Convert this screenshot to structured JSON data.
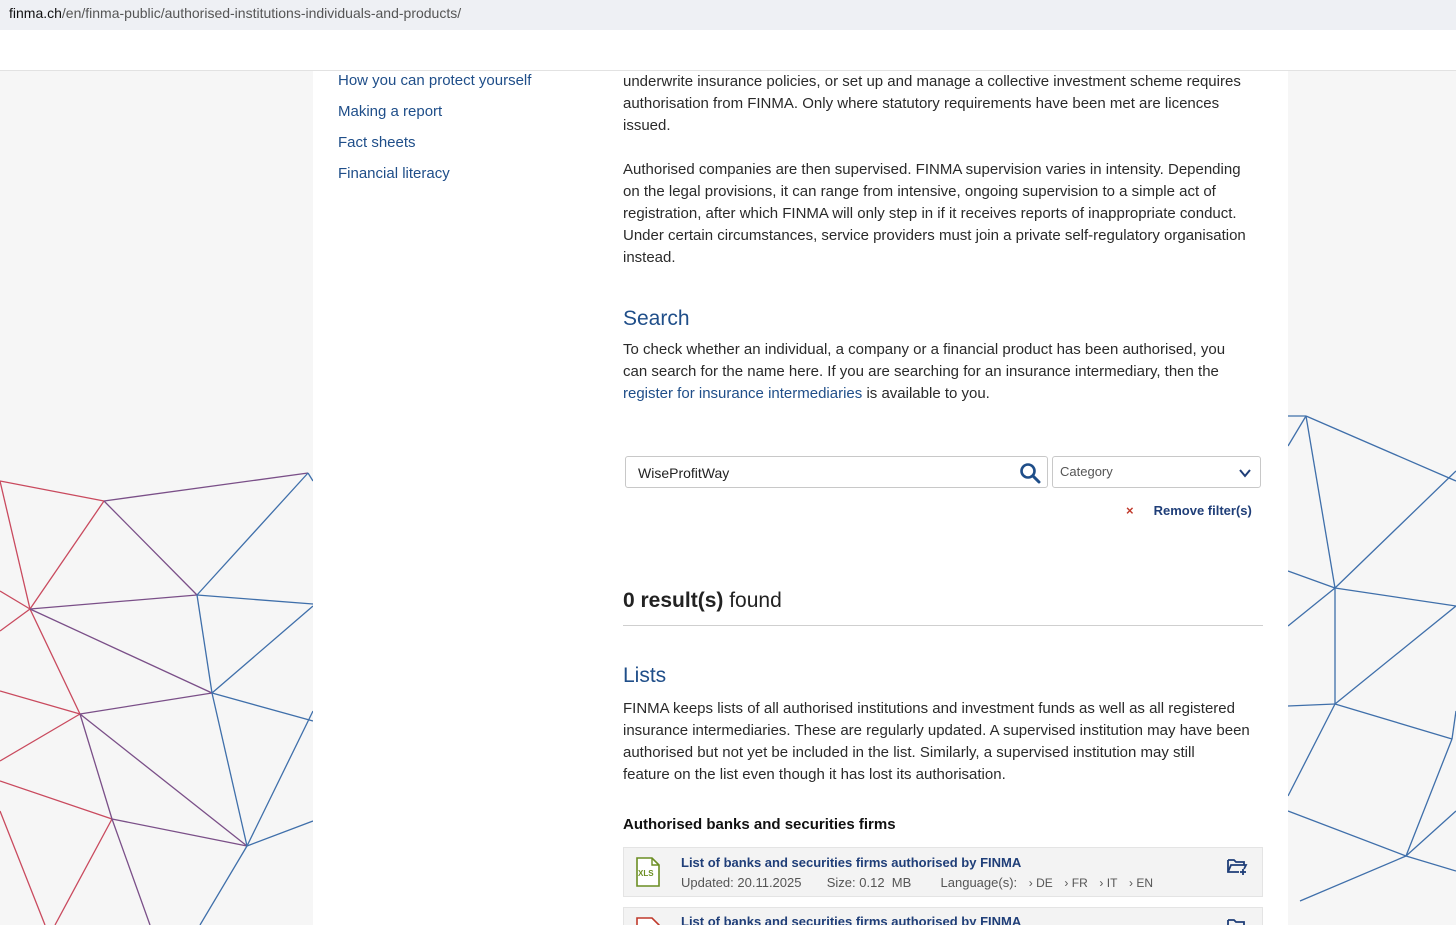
{
  "browser": {
    "url_domain": "finma.ch",
    "url_path": "/en/finma-public/authorised-institutions-individuals-and-products/"
  },
  "sidebar": {
    "items": [
      {
        "label": "How you can protect yourself"
      },
      {
        "label": "Making a report"
      },
      {
        "label": "Fact sheets"
      },
      {
        "label": "Financial literacy"
      }
    ]
  },
  "intro": {
    "paragraph1_lines": [
      "underwrite insurance policies, or set up and manage a collective investment scheme requires",
      "authorisation from FINMA. Only where statutory requirements have been met are licences",
      "issued."
    ],
    "paragraph2_lines": [
      "Authorised companies are then supervised. FINMA supervision varies in intensity. Depending",
      "on the legal provisions, it can range from intensive, ongoing supervision to a simple act of",
      "registration, after which FINMA will only step in if it receives reports of inappropriate conduct.",
      "Under certain circumstances, service providers must join a private self-regulatory organisation",
      "instead."
    ]
  },
  "search": {
    "heading": "Search",
    "text_line1": "To check whether an individual, a company or a financial product has been authorised, you",
    "text_line2": "can search for the name here. If you are searching for an insurance intermediary, then the",
    "link_text": "register for insurance intermediaries",
    "text_after_link": " is available to you.",
    "query_value": "WiseProfitWay",
    "category_label": "Category",
    "remove_filter_label": "Remove filter(s)",
    "remove_icon": "×"
  },
  "results": {
    "count_label": "0 result(s)",
    "suffix": " found"
  },
  "lists": {
    "heading": "Lists",
    "paragraph_lines": [
      "FINMA keeps lists of all authorised institutions and investment funds as well as all registered",
      "insurance intermediaries. These are regularly updated. A supervised institution may have been",
      "authorised but not yet be included in the list. Similarly, a supervised institution may still",
      "feature on the list even though it has lost its authorisation."
    ],
    "subheading": "Authorised banks and securities firms",
    "files": [
      {
        "icon": "xls-file-icon",
        "icon_text": "XLS",
        "title": "List of banks and securities firms authorised by FINMA",
        "updated": "Updated: 20.11.2025",
        "size": "Size: 0.12  MB",
        "languages_label": "Language(s):",
        "languages": [
          "DE",
          "FR",
          "IT",
          "EN"
        ]
      },
      {
        "icon": "pdf-file-icon",
        "title": "List of banks and securities firms authorised by FINMA"
      }
    ]
  },
  "colors": {
    "link": "#1f4e89",
    "dark_link": "#1f3e78",
    "remove_x": "#c0392b"
  }
}
